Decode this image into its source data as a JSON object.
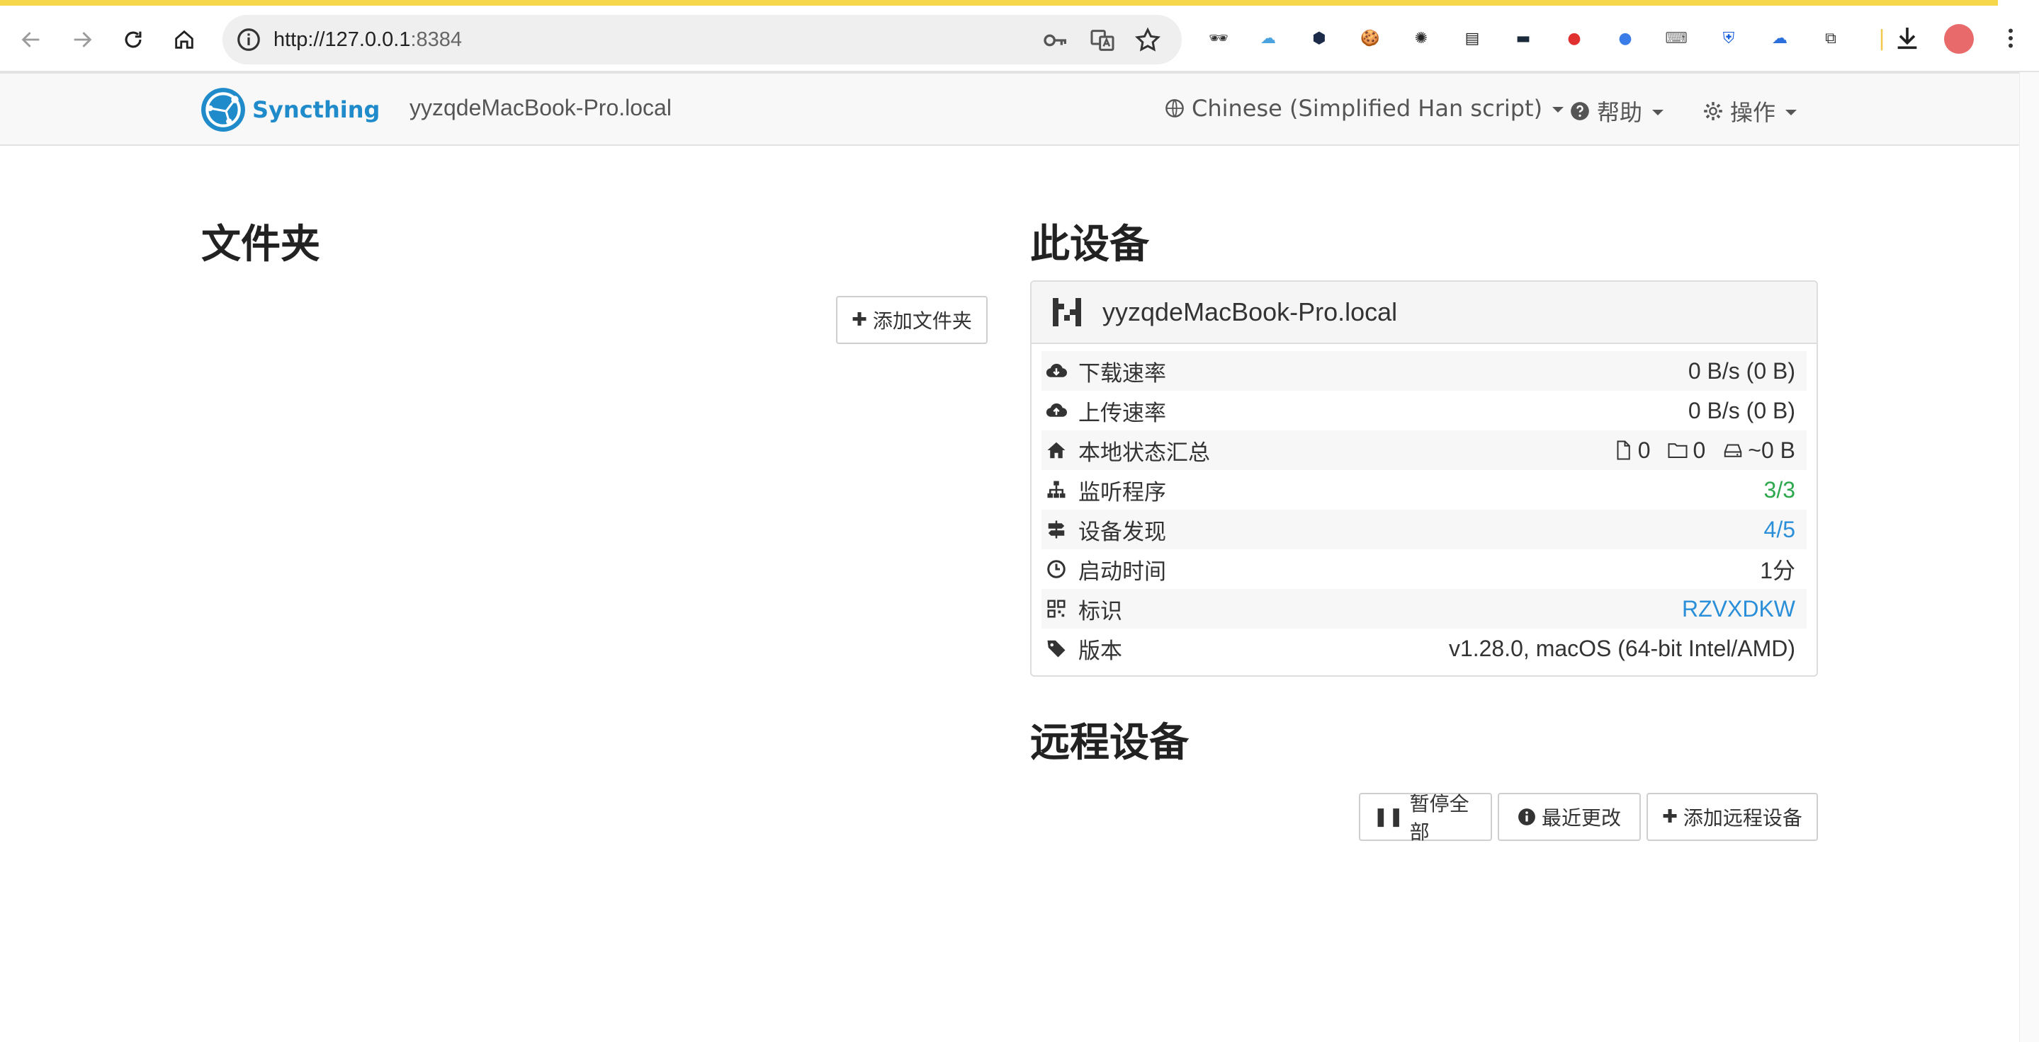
{
  "browser": {
    "url_host": "http://127.0.0.1",
    "url_port": ":8384",
    "extensions": [
      {
        "name": "spy-extension-icon",
        "glyph": "🕶",
        "color": "#333333"
      },
      {
        "name": "cloud-extension-icon",
        "glyph": "☁",
        "color": "#4aa3df"
      },
      {
        "name": "hex-extension-icon",
        "glyph": "⬢",
        "color": "#1c2b4a"
      },
      {
        "name": "cookie-extension-icon",
        "glyph": "🍪",
        "color": "#c98b3c"
      },
      {
        "name": "openai-extension-icon",
        "glyph": "✺",
        "color": "#222222"
      },
      {
        "name": "subtitle-extension-icon",
        "glyph": "▤",
        "color": "#222222"
      },
      {
        "name": "caption-extension-icon",
        "glyph": "▬",
        "color": "#1b2a3a"
      },
      {
        "name": "red-app-extension-icon",
        "glyph": "●",
        "color": "#e03030"
      },
      {
        "name": "blue-dot-extension-icon",
        "glyph": "●",
        "color": "#3b7de8"
      },
      {
        "name": "keyboard-extension-icon",
        "glyph": "⌨",
        "color": "#666666"
      },
      {
        "name": "bitwarden-extension-icon",
        "glyph": "⛨",
        "color": "#175ddc"
      },
      {
        "name": "cloud-sync-extension-icon",
        "glyph": "☁",
        "color": "#2a6fdb"
      },
      {
        "name": "puzzle-extensions-icon",
        "glyph": "⧉",
        "color": "#333333"
      }
    ]
  },
  "navbar": {
    "brand": "Syncthing",
    "device_name": "yyzqdeMacBook-Pro.local",
    "language": "Chinese (Simplified Han script)",
    "help": "帮助",
    "actions": "操作"
  },
  "folders": {
    "title": "文件夹",
    "add_button": "添加文件夹"
  },
  "this_device": {
    "title": "此设备",
    "name": "yyzqdeMacBook-Pro.local",
    "rows": [
      {
        "label": "下载速率",
        "value": "0 B/s (0 B)"
      },
      {
        "label": "上传速率",
        "value": "0 B/s (0 B)"
      },
      {
        "label": "本地状态汇总",
        "files": "0",
        "dirs": "0",
        "size": "~0 B"
      },
      {
        "label": "监听程序",
        "value": "3/3"
      },
      {
        "label": "设备发现",
        "value": "4/5"
      },
      {
        "label": "启动时间",
        "value": "1分"
      },
      {
        "label": "标识",
        "value": "RZVXDKW"
      },
      {
        "label": "版本",
        "value": "v1.28.0, macOS (64-bit Intel/AMD)"
      }
    ]
  },
  "remote_devices": {
    "title": "远程设备",
    "pause_all": "暂停全部",
    "recent_changes": "最近更改",
    "add_remote": "添加远程设备"
  },
  "colors": {
    "accent": "#1f8bcb",
    "ok": "#2ea84e",
    "link": "#2a8fd8"
  }
}
